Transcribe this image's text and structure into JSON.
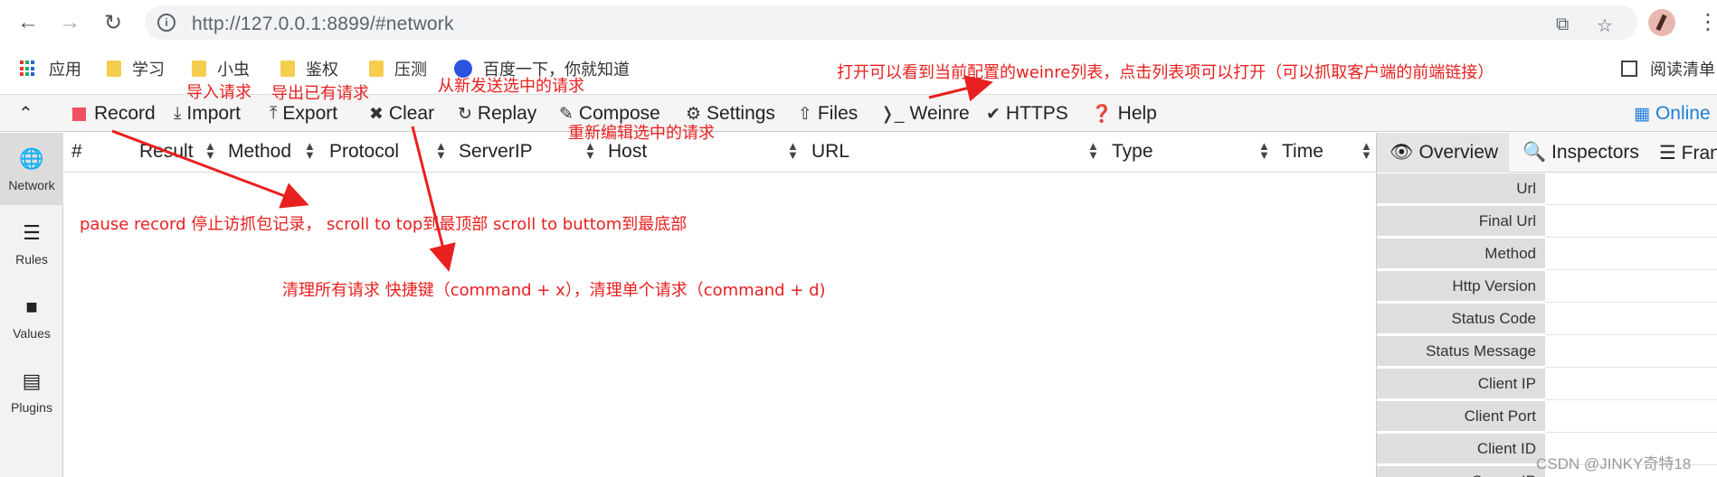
{
  "browser": {
    "url": "http://127.0.0.1:8899/#network",
    "icons": {
      "back": "arrow-left-icon",
      "forward": "arrow-right-icon",
      "reload": "reload-icon",
      "site_info": "info-icon",
      "share": "share-icon",
      "bookmark": "star-icon",
      "menu": "kebab-menu-icon"
    },
    "bookmarks": [
      {
        "label": "应用",
        "icon": "apps-grid-icon"
      },
      {
        "label": "学习",
        "icon": "folder-icon"
      },
      {
        "label": "小虫",
        "icon": "folder-icon"
      },
      {
        "label": "鉴权",
        "icon": "folder-icon"
      },
      {
        "label": "压测",
        "icon": "folder-icon"
      },
      {
        "label": "百度一下，你就知道",
        "icon": "baidu-paw-icon"
      }
    ],
    "reading_list": "阅读清单"
  },
  "toolbar": {
    "record": "Record",
    "import": "Import",
    "export": "Export",
    "clear": "Clear",
    "replay": "Replay",
    "compose": "Compose",
    "settings": "Settings",
    "files": "Files",
    "weinre": "Weinre",
    "https": "HTTPS",
    "help": "Help",
    "online": "Online"
  },
  "sidenav": [
    {
      "label": "Network",
      "icon": "globe-icon",
      "active": true
    },
    {
      "label": "Rules",
      "icon": "list-icon",
      "active": false
    },
    {
      "label": "Values",
      "icon": "folder-icon",
      "active": false
    },
    {
      "label": "Plugins",
      "icon": "plugin-list-icon",
      "active": false
    }
  ],
  "columns": [
    "#",
    "Result",
    "Method",
    "Protocol",
    "ServerIP",
    "Host",
    "URL",
    "Type",
    "Time"
  ],
  "right_panel": {
    "tabs": [
      "Overview",
      "Inspectors",
      "Fran"
    ],
    "properties": [
      "Url",
      "Final Url",
      "Method",
      "Http Version",
      "Status Code",
      "Status Message",
      "Client IP",
      "Client Port",
      "Client ID",
      "Server IP"
    ]
  },
  "annotations": {
    "import_note": "导入请求",
    "export_note": "导出已有请求",
    "replay_note": "从新发送选中的请求",
    "compose_note": "重新编辑选中的请求",
    "weinre_note": "打开可以看到当前配置的weinre列表，点击列表项可以打开（可以抓取客户端的前端链接）",
    "record_note": "pause record 停止访抓包记录，  scroll to top到最顶部 scroll to buttom到最底部",
    "clear_note": "清理所有请求 快捷键（command + x），清理单个请求（command + d)",
    "color": "#e8201f"
  },
  "watermark": "CSDN @JINKY奇特18"
}
